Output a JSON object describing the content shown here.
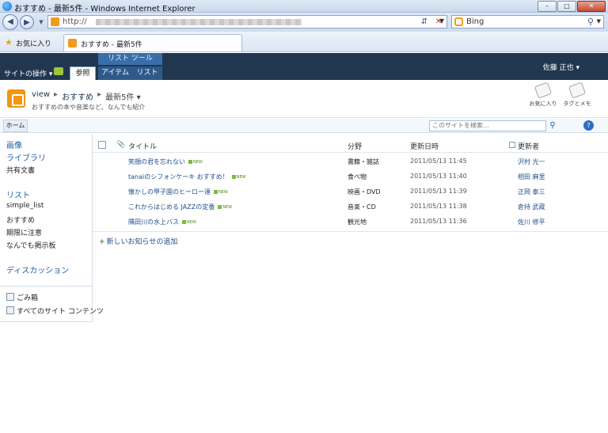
{
  "window": {
    "title": "おすすめ - 最新5件 - Windows Internet Explorer",
    "address": "http://",
    "search_engine": "Bing",
    "favorites_label": "お気に入り",
    "tab_title": "おすすめ - 最新5件"
  },
  "ribbon": {
    "site_actions": "サイトの操作",
    "contextual_group": "リスト ツール",
    "tabs": [
      {
        "label": "参照",
        "active": true
      },
      {
        "label": "アイテム",
        "active": false
      },
      {
        "label": "リスト",
        "active": false
      }
    ],
    "user": "佐藤 正也"
  },
  "title_area": {
    "breadcrumb": [
      "view",
      "おすすめ",
      "最新5件"
    ],
    "subtitle": "おすすめの本や音楽など、なんでも紹介",
    "tools": [
      {
        "label": "お気に入り",
        "icon": "tag-icon"
      },
      {
        "label": "タグとメモ",
        "icon": "tag-note-icon"
      }
    ]
  },
  "top_bar": {
    "home": "ホーム",
    "search_placeholder": "このサイトを検索..."
  },
  "quick_launch": {
    "pictures": "画像",
    "libraries": "ライブラリ",
    "shared_docs": "共有文書",
    "lists": "リスト",
    "list_items": [
      "simple_list",
      "おすすめ",
      "期限に注意",
      "なんでも掲示板"
    ],
    "discussions": "ディスカッション",
    "recycle_bin": "ごみ箱",
    "all_content": "すべてのサイト コンテンツ"
  },
  "list": {
    "columns": {
      "title": "タイトル",
      "category": "分野",
      "modified": "更新日時",
      "modified_by": "更新者"
    },
    "rows": [
      {
        "title": "笑顔の君を忘れない",
        "category": "書籍・雑誌",
        "modified": "2011/05/13 11:45",
        "modified_by": "沢村 光一"
      },
      {
        "title": "tanaiのシフォンケーキ おすすめ！",
        "category": "食べ物",
        "modified": "2011/05/13 11:40",
        "modified_by": "相田 麻里"
      },
      {
        "title": "懐かしの甲子園のヒーロー達",
        "category": "映画・DVD",
        "modified": "2011/05/13 11:39",
        "modified_by": "正岡 泰三"
      },
      {
        "title": "これからはじめる JAZZの定番",
        "category": "音楽・CD",
        "modified": "2011/05/13 11:38",
        "modified_by": "倉持 武蔵"
      },
      {
        "title": "隅田川の水上バス",
        "category": "観光地",
        "modified": "2011/05/13 11:36",
        "modified_by": "佐川 修平"
      }
    ],
    "new_badge": "NEW",
    "add_new": "新しいお知らせの追加"
  }
}
